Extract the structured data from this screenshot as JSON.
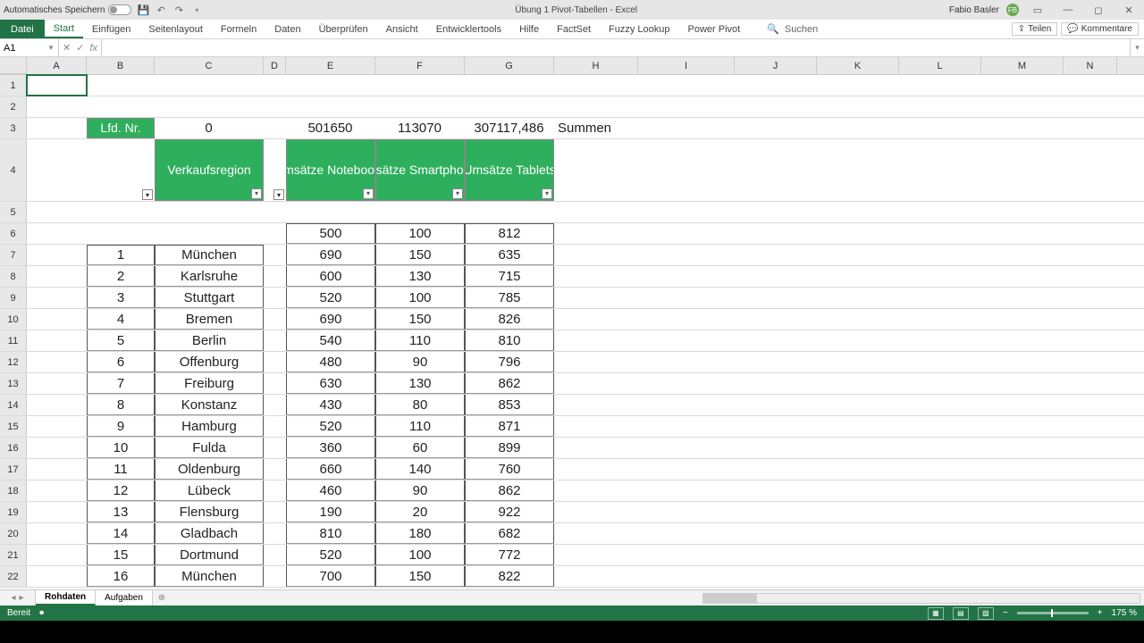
{
  "titlebar": {
    "autosave_label": "Automatisches Speichern",
    "doc_title": "Übung 1 Pivot-Tabellen - Excel",
    "user_name": "Fabio Basler",
    "user_initials": "FB"
  },
  "ribbon": {
    "file": "Datei",
    "tabs": [
      "Start",
      "Einfügen",
      "Seitenlayout",
      "Formeln",
      "Daten",
      "Überprüfen",
      "Ansicht",
      "Entwicklertools",
      "Hilfe",
      "FactSet",
      "Fuzzy Lookup",
      "Power Pivot"
    ],
    "search_placeholder": "Suchen",
    "share": "Teilen",
    "comments": "Kommentare"
  },
  "namebox": "A1",
  "formula": "",
  "columns": [
    "A",
    "B",
    "C",
    "D",
    "E",
    "F",
    "G",
    "H",
    "I",
    "J",
    "K",
    "L",
    "M",
    "N"
  ],
  "row3": {
    "b_label": "Lfd. Nr.",
    "c_val": "0",
    "e_val": "501650",
    "f_val": "113070",
    "g_val": "307117,486",
    "h_label": "Summen"
  },
  "row4": {
    "c_hdr": "Verkaufsregion",
    "e_hdr": "Umsätze Notebooks",
    "f_hdr": "Umsätze Smartphones",
    "g_hdr": "Umsätze Tablets"
  },
  "data_rows": [
    {
      "n": "",
      "r": "",
      "e": "500",
      "f": "100",
      "g": "812"
    },
    {
      "n": "1",
      "r": "München",
      "e": "690",
      "f": "150",
      "g": "635"
    },
    {
      "n": "2",
      "r": "Karlsruhe",
      "e": "600",
      "f": "130",
      "g": "715"
    },
    {
      "n": "3",
      "r": "Stuttgart",
      "e": "520",
      "f": "100",
      "g": "785"
    },
    {
      "n": "4",
      "r": "Bremen",
      "e": "690",
      "f": "150",
      "g": "826"
    },
    {
      "n": "5",
      "r": "Berlin",
      "e": "540",
      "f": "110",
      "g": "810"
    },
    {
      "n": "6",
      "r": "Offenburg",
      "e": "480",
      "f": "90",
      "g": "796"
    },
    {
      "n": "7",
      "r": "Freiburg",
      "e": "630",
      "f": "130",
      "g": "862"
    },
    {
      "n": "8",
      "r": "Konstanz",
      "e": "430",
      "f": "80",
      "g": "853"
    },
    {
      "n": "9",
      "r": "Hamburg",
      "e": "520",
      "f": "110",
      "g": "871"
    },
    {
      "n": "10",
      "r": "Fulda",
      "e": "360",
      "f": "60",
      "g": "899"
    },
    {
      "n": "11",
      "r": "Oldenburg",
      "e": "660",
      "f": "140",
      "g": "760"
    },
    {
      "n": "12",
      "r": "Lübeck",
      "e": "460",
      "f": "90",
      "g": "862"
    },
    {
      "n": "13",
      "r": "Flensburg",
      "e": "190",
      "f": "20",
      "g": "922"
    },
    {
      "n": "14",
      "r": "Gladbach",
      "e": "810",
      "f": "180",
      "g": "682"
    },
    {
      "n": "15",
      "r": "Dortmund",
      "e": "520",
      "f": "100",
      "g": "772"
    },
    {
      "n": "16",
      "r": "München",
      "e": "700",
      "f": "150",
      "g": "822"
    }
  ],
  "sheets": {
    "active": "Rohdaten",
    "other": "Aufgaben"
  },
  "status": {
    "ready": "Bereit",
    "zoom": "175 %"
  }
}
